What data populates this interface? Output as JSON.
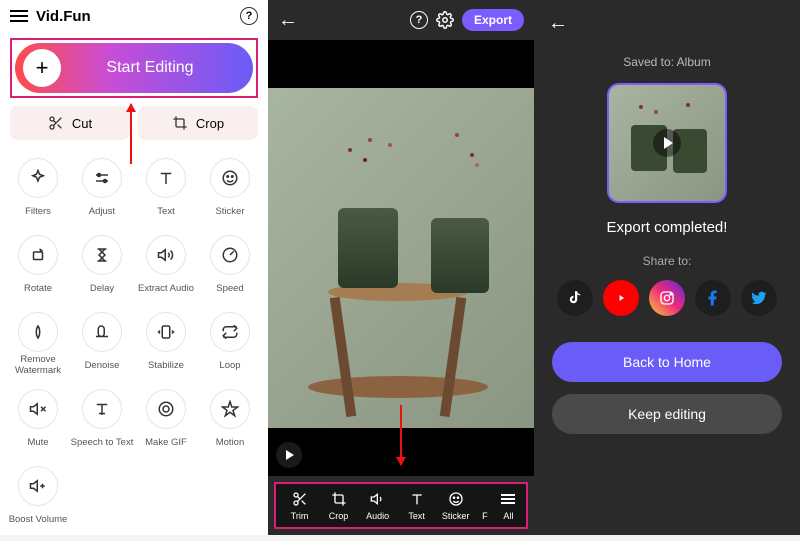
{
  "app": {
    "title": "Vid.Fun"
  },
  "home": {
    "start_label": "Start Editing",
    "quick": {
      "cut": "Cut",
      "crop": "Crop"
    },
    "tools": [
      {
        "id": "filters",
        "label": "Filters"
      },
      {
        "id": "adjust",
        "label": "Adjust"
      },
      {
        "id": "text",
        "label": "Text"
      },
      {
        "id": "sticker",
        "label": "Sticker"
      },
      {
        "id": "rotate",
        "label": "Rotate"
      },
      {
        "id": "delay",
        "label": "Delay"
      },
      {
        "id": "extract-audio",
        "label": "Extract Audio"
      },
      {
        "id": "speed",
        "label": "Speed"
      },
      {
        "id": "remove-watermark",
        "label": "Remove Watermark"
      },
      {
        "id": "denoise",
        "label": "Denoise"
      },
      {
        "id": "stabilize",
        "label": "Stabilize"
      },
      {
        "id": "loop",
        "label": "Loop"
      },
      {
        "id": "mute",
        "label": "Mute"
      },
      {
        "id": "speech-to-text",
        "label": "Speech to Text"
      },
      {
        "id": "make-gif",
        "label": "Make GIF"
      },
      {
        "id": "motion",
        "label": "Motion"
      },
      {
        "id": "boost-volume",
        "label": "Boost Volume"
      }
    ]
  },
  "editor": {
    "export_label": "Export",
    "toolbar": [
      {
        "id": "trim",
        "label": "Trim"
      },
      {
        "id": "crop",
        "label": "Crop"
      },
      {
        "id": "audio",
        "label": "Audio"
      },
      {
        "id": "text",
        "label": "Text"
      },
      {
        "id": "sticker",
        "label": "Sticker"
      },
      {
        "id": "f",
        "label": "F"
      },
      {
        "id": "all",
        "label": "All"
      }
    ]
  },
  "export": {
    "saved_to": "Saved to: Album",
    "completed": "Export completed!",
    "share_to": "Share to:",
    "socials": [
      {
        "id": "tiktok",
        "name": "TikTok"
      },
      {
        "id": "youtube",
        "name": "YouTube"
      },
      {
        "id": "instagram",
        "name": "Instagram"
      },
      {
        "id": "facebook",
        "name": "Facebook"
      },
      {
        "id": "twitter",
        "name": "Twitter"
      }
    ],
    "back_home": "Back to Home",
    "keep_editing": "Keep editing"
  }
}
